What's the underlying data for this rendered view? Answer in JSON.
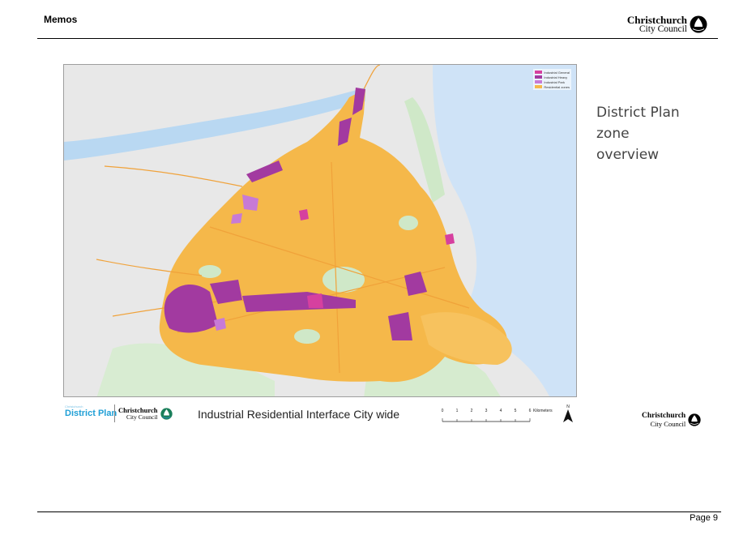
{
  "header": {
    "title": "Memos",
    "logo_line1": "Christchurch",
    "logo_line2": "City Council"
  },
  "map": {
    "legend": [
      {
        "label": "Industrial General",
        "color": "#d6409f"
      },
      {
        "label": "Industrial Heavy",
        "color": "#a23aa0"
      },
      {
        "label": "Industrial Park",
        "color": "#c77ad6"
      },
      {
        "label": "Residential zones",
        "color": "#f5b84a"
      }
    ],
    "colors": {
      "water": "#cfe3f7",
      "river": "#b9d8f2",
      "land": "#e8e8e8",
      "green": "#cfe8c8",
      "residential": "#f5b84a",
      "road": "#f0a23a"
    }
  },
  "footer_band": {
    "district_plan_small": "Christchurch",
    "district_plan": "District Plan",
    "logo_line1": "Christchurch",
    "logo_line2": "City Council",
    "caption": "Industrial Residential Interface City wide",
    "scale_ticks": [
      "0",
      "1",
      "2",
      "3",
      "4",
      "5",
      "6"
    ],
    "scale_unit": "Kilometers",
    "north": "N"
  },
  "side_heading": {
    "line1": "District Plan",
    "line2": "zone",
    "line3": "overview"
  },
  "bottom_logo": {
    "logo_line1": "Christchurch",
    "logo_line2": "City Council"
  },
  "footer": {
    "page_label": "Page 9"
  }
}
